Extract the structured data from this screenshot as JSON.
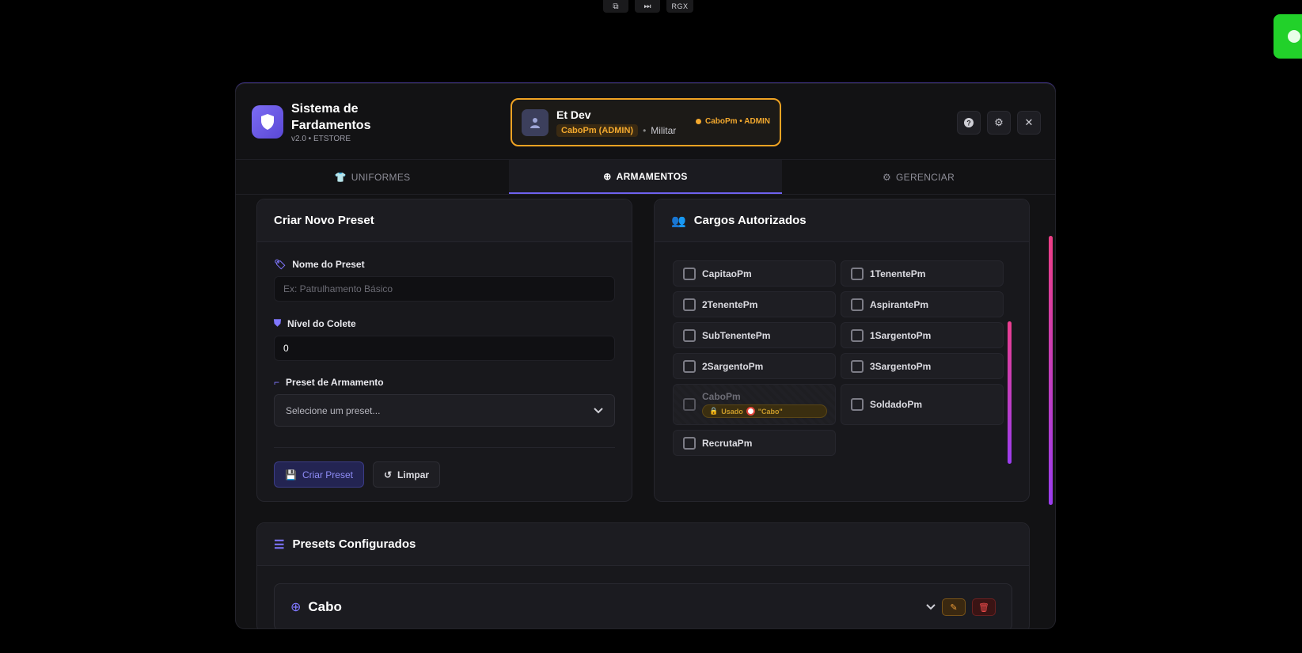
{
  "overlay": {
    "tools": [
      "share-icon",
      "skip-icon"
    ],
    "rgx_label": "RGX"
  },
  "app": {
    "title": "Sistema de Fardamentos",
    "subtitle": "v2.0 • ETSTORE",
    "accent": "#6f62f0"
  },
  "user": {
    "name": "Et Dev",
    "role_chip": "CaboPm (ADMIN)",
    "separator": "•",
    "type": "Militar",
    "status": "CaboPm • ADMIN",
    "status_color": "#f3a92e"
  },
  "tabs": [
    {
      "label": "UNIFORMES",
      "icon": "shirt-icon",
      "active": false
    },
    {
      "label": "ARMAMENTOS",
      "icon": "crosshair-icon",
      "active": true
    },
    {
      "label": "GERENCIAR",
      "icon": "gears-icon",
      "active": false
    }
  ],
  "create_preset": {
    "title": "Criar Novo Preset",
    "name_label": "Nome do Preset",
    "name_placeholder": "Ex: Patrulhamento Básico",
    "vest_label": "Nível do Colete",
    "vest_value": "0",
    "weapon_label": "Preset de Armamento",
    "weapon_placeholder": "Selecione um preset...",
    "create_button": "Criar Preset",
    "clear_button": "Limpar"
  },
  "roles_panel": {
    "title": "Cargos Autorizados",
    "roles": [
      {
        "label": "CapitaoPm",
        "checked": false,
        "disabled": false
      },
      {
        "label": "1TenentePm",
        "checked": false,
        "disabled": false
      },
      {
        "label": "2TenentePm",
        "checked": false,
        "disabled": false
      },
      {
        "label": "AspirantePm",
        "checked": false,
        "disabled": false
      },
      {
        "label": "SubTenentePm",
        "checked": false,
        "disabled": false
      },
      {
        "label": "1SargentoPm",
        "checked": false,
        "disabled": false
      },
      {
        "label": "2SargentoPm",
        "checked": false,
        "disabled": false
      },
      {
        "label": "3SargentoPm",
        "checked": false,
        "disabled": false
      },
      {
        "label": "CaboPm",
        "checked": false,
        "disabled": true,
        "used_prefix": "Usado",
        "used_in": "\"Cabo\""
      },
      {
        "label": "SoldadoPm",
        "checked": false,
        "disabled": false
      },
      {
        "label": "RecrutaPm",
        "checked": false,
        "disabled": false
      }
    ]
  },
  "presets": {
    "title": "Presets Configurados",
    "items": [
      {
        "name": "Cabo"
      }
    ]
  }
}
